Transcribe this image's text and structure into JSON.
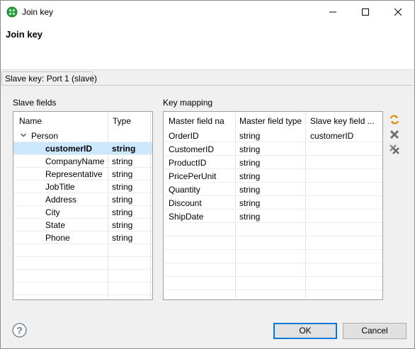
{
  "window": {
    "title": "Join key",
    "header_title": "Join key"
  },
  "tab": {
    "label": "Slave key: Port 1 (slave)"
  },
  "slave_fields": {
    "label": "Slave fields",
    "columns": [
      "Name",
      "Type"
    ],
    "group": "Person",
    "rows": [
      {
        "name": "customerID",
        "type": "string",
        "selected": true
      },
      {
        "name": "CompanyName",
        "type": "string"
      },
      {
        "name": "Representative",
        "type": "string"
      },
      {
        "name": "JobTitle",
        "type": "string"
      },
      {
        "name": "Address",
        "type": "string"
      },
      {
        "name": "City",
        "type": "string"
      },
      {
        "name": "State",
        "type": "string"
      },
      {
        "name": "Phone",
        "type": "string"
      }
    ]
  },
  "key_mapping": {
    "label": "Key mapping",
    "columns": [
      "Master field na",
      "Master field type",
      "Slave key field ..."
    ],
    "rows": [
      {
        "master": "OrderID",
        "type": "string",
        "slave": "customerID"
      },
      {
        "master": "CustomerID",
        "type": "string",
        "slave": ""
      },
      {
        "master": "ProductID",
        "type": "string",
        "slave": ""
      },
      {
        "master": "PricePerUnit",
        "type": "string",
        "slave": ""
      },
      {
        "master": "Quantity",
        "type": "string",
        "slave": ""
      },
      {
        "master": "Discount",
        "type": "string",
        "slave": ""
      },
      {
        "master": "ShipDate",
        "type": "string",
        "slave": ""
      }
    ]
  },
  "buttons": {
    "ok": "OK",
    "cancel": "Cancel"
  },
  "colors": {
    "selection": "#cce8ff",
    "default_button_border": "#0078d7",
    "app_icon": "#27a13a"
  }
}
